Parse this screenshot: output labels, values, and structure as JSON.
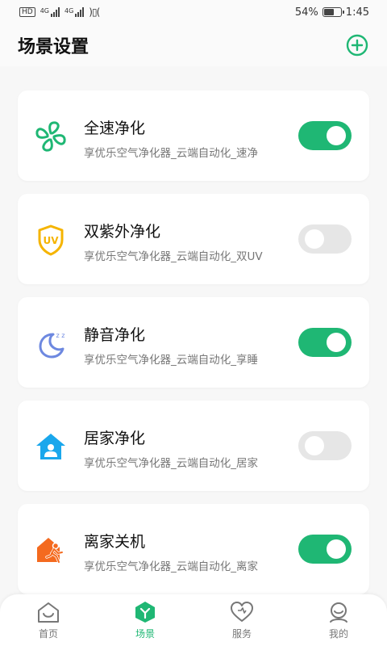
{
  "status_bar": {
    "left_hd": "HD",
    "net1": "4G",
    "net2": "4G",
    "battery": "54%",
    "battery_level": 0.54,
    "time": "1:45"
  },
  "header": {
    "title": "场景设置",
    "add_icon": "plus-circle-icon"
  },
  "colors": {
    "accent": "#1fb774",
    "toggle_off": "#e6e6e6",
    "uv_yellow": "#f5b400",
    "moon_blue": "#6d88e0",
    "home_blue": "#1aa7ec",
    "leave_orange": "#f46a1f"
  },
  "scenes": [
    {
      "title": "全速净化",
      "subtitle": "享优乐空气净化器_云端自动化_速净",
      "icon": "fan-icon",
      "enabled": true
    },
    {
      "title": "双紫外净化",
      "subtitle": "享优乐空气净化器_云端自动化_双UV",
      "icon": "uv-shield-icon",
      "icon_text": "UV",
      "enabled": false
    },
    {
      "title": "静音净化",
      "subtitle": "享优乐空气净化器_云端自动化_享睡",
      "icon": "moon-icon",
      "icon_text": "z z",
      "enabled": true
    },
    {
      "title": "居家净化",
      "subtitle": "享优乐空气净化器_云端自动化_居家",
      "icon": "home-person-icon",
      "enabled": false
    },
    {
      "title": "离家关机",
      "subtitle": "享优乐空气净化器_云端自动化_离家",
      "icon": "leave-home-icon",
      "enabled": true
    }
  ],
  "tabs": [
    {
      "label": "首页",
      "icon": "home-tab-icon",
      "active": false
    },
    {
      "label": "场景",
      "icon": "scene-tab-icon",
      "active": true
    },
    {
      "label": "服务",
      "icon": "heart-tab-icon",
      "active": false
    },
    {
      "label": "我的",
      "icon": "profile-tab-icon",
      "active": false
    }
  ]
}
